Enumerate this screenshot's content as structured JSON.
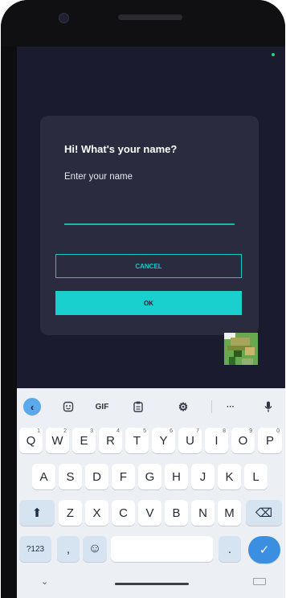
{
  "dialog": {
    "title": "Hi! What's your name?",
    "prompt": "Enter your name",
    "input_value": "",
    "cancel_label": "CANCEL",
    "ok_label": "OK"
  },
  "keyboard": {
    "toolbar": {
      "back_icon": "chevron-left-icon",
      "sticker_icon": "sticker-icon",
      "gif_label": "GIF",
      "clipboard_icon": "clipboard-icon",
      "settings_icon": "gear-icon",
      "more_label": "···",
      "mic_icon": "microphone-icon"
    },
    "row1": [
      {
        "label": "Q",
        "hint": "1"
      },
      {
        "label": "W",
        "hint": "2"
      },
      {
        "label": "E",
        "hint": "3"
      },
      {
        "label": "R",
        "hint": "4"
      },
      {
        "label": "T",
        "hint": "5"
      },
      {
        "label": "Y",
        "hint": "6"
      },
      {
        "label": "U",
        "hint": "7"
      },
      {
        "label": "I",
        "hint": "8"
      },
      {
        "label": "O",
        "hint": "9"
      },
      {
        "label": "P",
        "hint": "0"
      }
    ],
    "row2": [
      "A",
      "S",
      "D",
      "F",
      "G",
      "H",
      "J",
      "K",
      "L"
    ],
    "row3": [
      "Z",
      "X",
      "C",
      "V",
      "B",
      "N",
      "M"
    ],
    "shift_glyph": "⬆",
    "backspace_glyph": "⌫",
    "symbols_label": "?123",
    "comma_label": ",",
    "emoji_glyph": "☺",
    "period_label": ".",
    "enter_glyph": "✓",
    "hide_glyph": "⌄"
  },
  "colors": {
    "screen_bg": "#1a1b2e",
    "dialog_bg": "#2a2b3f",
    "accent": "#1ad0cf"
  }
}
